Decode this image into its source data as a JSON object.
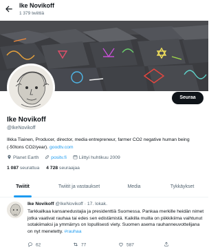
{
  "header": {
    "name": "Ike Novikoff",
    "tweet_count": "1 379 twiittiä"
  },
  "profile": {
    "follow_label": "Seuraa",
    "name": "Ike Novikoff",
    "handle": "@IkeNovikoff",
    "bio_text": "Ilkka Tiainen, Producer, director, media entrepreneur, farmer CO2 negative human being (-50tons CO2/year). ",
    "bio_link": "goodtv.com",
    "location": "Planet Earth",
    "website": "positv.fi",
    "joined": "Liittyi huhtikuu 2009",
    "following_count": "1 087",
    "following_label": "seurattua",
    "followers_count": "4 728",
    "followers_label": "seuraajaa"
  },
  "tabs": [
    {
      "label": "Twiitit",
      "active": true
    },
    {
      "label": "Twiitit ja vastaukset",
      "active": false
    },
    {
      "label": "Media",
      "active": false
    },
    {
      "label": "Tykkäykset",
      "active": false
    }
  ],
  "tweet": {
    "name": "Ike Novikoff",
    "handle": "@IkeNovikoff",
    "date": "· 17. lokak.",
    "text": "Tarkkailkaa kansanedustajia ja presidenttiä Suomessa. Pankaa merkille heidän nimet jotka vaativat rauhaa tai edes sen edistämistä. Kaikilla muilla on piikkikiima vaihtunut sotakiimaksi ja ymmärrys on lopullisesti viety. Suomen asema rauhanneuvottelijana on nyt menetetty. ",
    "hashtag": "#rauhaa",
    "replies": "62",
    "retweets": "77",
    "likes": "587"
  },
  "colors": {
    "accent": "#1d9bf0",
    "text": "#0f1419",
    "muted": "#536471"
  },
  "icons": [
    "back-arrow-icon",
    "location-pin-icon",
    "link-icon",
    "calendar-icon",
    "reply-icon",
    "retweet-icon",
    "like-icon",
    "share-icon"
  ]
}
